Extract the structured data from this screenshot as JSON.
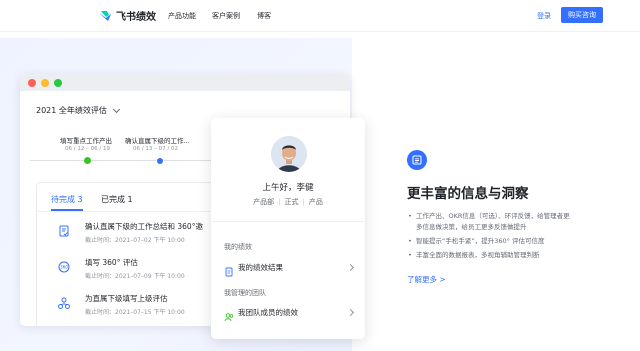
{
  "nav": {
    "brand": "飞书绩效",
    "links": [
      "产品功能",
      "客户案例",
      "博客"
    ],
    "login": "登录",
    "buy": "购买咨询"
  },
  "window": {
    "title": "2021 全年绩效评估",
    "steps": [
      {
        "label": "填写重点工作产出",
        "date": "06 / 12 – 06 / 19",
        "status": "done"
      },
      {
        "label": "确认直属下级的工作...",
        "date": "06 / 13 – 07 / 02",
        "status": "current"
      }
    ],
    "tabs": [
      {
        "label": "待完成 3",
        "active": true
      },
      {
        "label": "已完成 1",
        "active": false
      }
    ],
    "tasks": [
      {
        "title": "确认直属下级的工作总结和 360°邀",
        "time": "截止时间：2021–07–02 下午 10:00",
        "icon": "document-check-icon"
      },
      {
        "title": "填写 360° 评估",
        "time": "截止时间：2021–07–09 下午 10:00",
        "icon": "360-icon"
      },
      {
        "title": "为直属下级填写上级评估",
        "time": "截止时间：2021–07–15 下午 10:00",
        "icon": "org-chart-icon"
      }
    ]
  },
  "profile": {
    "greeting": "上午好，李健",
    "tags": [
      "产品部",
      "正式",
      "产品"
    ],
    "my_section": "我的绩效",
    "my_item": "我的绩效结果",
    "team_section": "我管理的团队",
    "team_item": "我团队成员的绩效"
  },
  "feature": {
    "icon": "list-icon",
    "title": "更丰富的信息与洞察",
    "bullets": [
      [
        "工作产出、OKR信息（可选）、环评反馈，给管理者更",
        "多信息做决策，给员工更多反馈做提升"
      ],
      [
        "智能提示“手松手紧”，提升360° 评估可信度"
      ],
      [
        "丰富全面的数据报表，多视角辅助管理判断"
      ]
    ],
    "learn_more": "了解更多 >"
  },
  "colors": {
    "accent": "#3370ff",
    "done": "#34c724",
    "window_red": "#ff5f57",
    "window_yellow": "#febc2e",
    "window_green": "#28c840"
  }
}
